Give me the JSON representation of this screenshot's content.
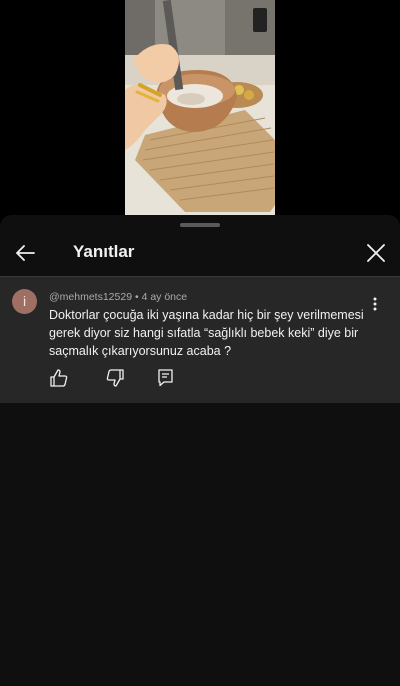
{
  "header": {
    "title": "Yanıtlar"
  },
  "comment": {
    "avatar_letter": "i",
    "author": "@mehmets12529",
    "separator": " • ",
    "time": "4 ay önce",
    "text": "Doktorlar çocuğa iki yaşına kadar hiç bir şey verilmemesi gerek diyor siz hangi sıfatla “sağlıklı bebek keki” diye bir saçmalık çıkarıyorsunuz acaba ?"
  },
  "icons": {
    "back": "arrow-left-icon",
    "close": "close-icon",
    "more": "more-vert-icon",
    "like": "thumb-up-icon",
    "dislike": "thumb-down-icon",
    "reply": "reply-comment-icon"
  },
  "colors": {
    "sheet_bg": "#0f0f0f",
    "comment_bg": "#272727",
    "avatar_bg": "#a06f63",
    "text": "#f1f1f1",
    "meta": "#aaaaaa"
  }
}
